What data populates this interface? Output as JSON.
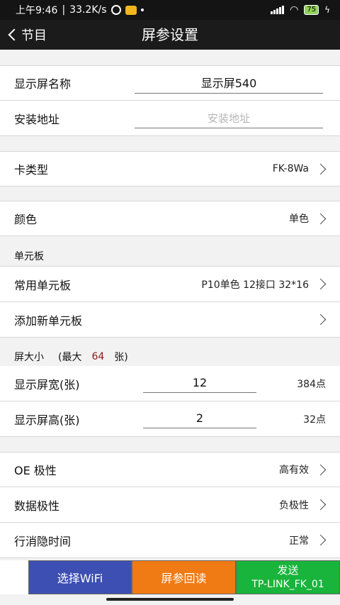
{
  "status_bar": {
    "time": "上午9:46",
    "speed": "33.2K/s",
    "battery": "75"
  },
  "nav": {
    "back_label": "节目",
    "title": "屏参设置"
  },
  "display_name": {
    "label": "显示屏名称",
    "value": "显示屏540"
  },
  "install_address": {
    "label": "安装地址",
    "placeholder": "安装地址"
  },
  "card_type": {
    "label": "卡类型",
    "value": "FK-8Wa"
  },
  "color": {
    "label": "颜色",
    "value": "单色"
  },
  "unit_board_section": {
    "title": "单元板"
  },
  "common_board": {
    "label": "常用单元板",
    "value": "P10单色 12接口 32*16"
  },
  "add_board": {
    "label": "添加新单元板"
  },
  "screen_size_section": {
    "prefix": "屏大小",
    "max_prefix": "(最大",
    "max_value": "64",
    "max_suffix": "张)"
  },
  "screen_width": {
    "label": "显示屏宽(张)",
    "value": "12",
    "unit": "384点"
  },
  "screen_height": {
    "label": "显示屏高(张)",
    "value": "2",
    "unit": "32点"
  },
  "oe_polarity": {
    "label": "OE 极性",
    "value": "高有效"
  },
  "data_polarity": {
    "label": "数据极性",
    "value": "负极性"
  },
  "blanking_time": {
    "label": "行消隐时间",
    "value": "正常"
  },
  "buttons": {
    "select_wifi": "选择WiFi",
    "readback": "屏参回读",
    "send": "发送",
    "send_network": "TP-LINK_FK_01"
  }
}
